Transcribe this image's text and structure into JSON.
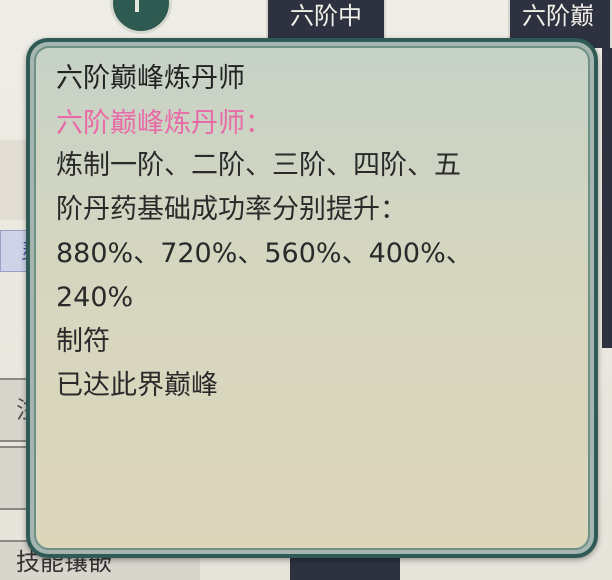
{
  "background": {
    "tab_1": "六阶中",
    "tab_2": "六阶巅",
    "left_panel_text": "灵",
    "left_button_1": "注",
    "bottom_button": "技能镶嵌"
  },
  "tooltip": {
    "title": "六阶巅峰炼丹师",
    "subtitle": "六阶巅峰炼丹师：",
    "description": "炼制一阶、二阶、三阶、四阶、五\n阶丹药基础成功率分别提升：\n880%、720%、560%、400%、\n240%",
    "line_1": "制符",
    "line_2": "已达此界巅峰"
  },
  "colors": {
    "frame": "#2f5a56",
    "subtitle": "#e86aa6",
    "tab": "#2e3240"
  }
}
